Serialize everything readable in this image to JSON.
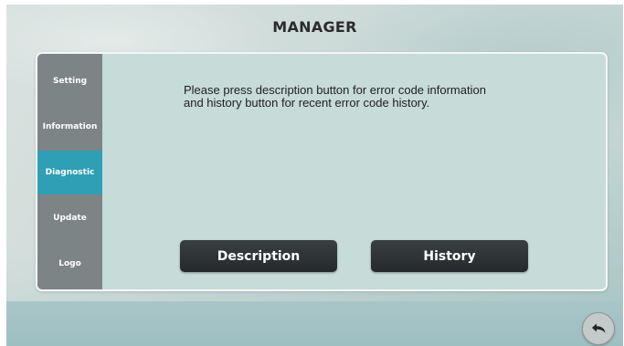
{
  "header": {
    "title": "MANAGER"
  },
  "sidebar": {
    "items": [
      {
        "label": "Setting",
        "active": false
      },
      {
        "label": "Information",
        "active": false
      },
      {
        "label": "Diagnostic",
        "active": true
      },
      {
        "label": "Update",
        "active": false
      },
      {
        "label": "Logo",
        "active": false
      }
    ]
  },
  "main": {
    "message_line1": "Please press description button for error code information",
    "message_line2": "and history button for recent error code history.",
    "description_label": "Description",
    "history_label": "History"
  },
  "footer": {
    "back_icon": "undo-arrow-icon"
  },
  "colors": {
    "sidebar": "#7d8486",
    "active_item": "#2f9fb6",
    "panel": "#c7dbd8",
    "button": "#2b2f31"
  }
}
